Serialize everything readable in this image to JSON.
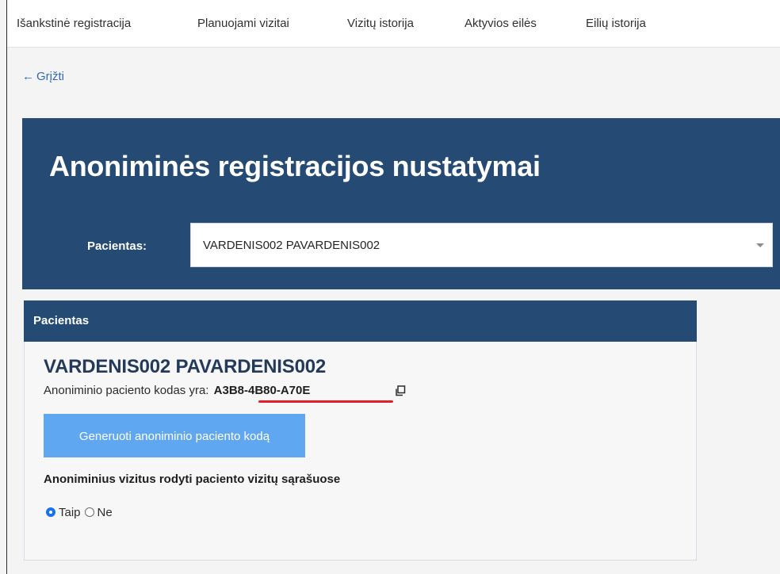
{
  "nav": {
    "items": [
      {
        "label": "Išankstinė registracija"
      },
      {
        "label": "Planuojami vizitai"
      },
      {
        "label": "Vizitų istorija"
      },
      {
        "label": "Aktyvios eilės"
      },
      {
        "label": "Eilių istorija"
      }
    ]
  },
  "back": {
    "arrow": "←",
    "label": "Grįžti"
  },
  "header": {
    "title": "Anoniminės registracijos nustatymai",
    "patient_label": "Pacientas:",
    "patient_selected": "VARDENIS002 PAVARDENIS002"
  },
  "card": {
    "title": "Pacientas",
    "patient_name": "VARDENIS002 PAVARDENIS002",
    "code_prefix": "Anoniminio paciento kodas yra:",
    "code_value": "A3B8-4B80-A70E",
    "copy_icon": "copy-icon",
    "generate_button": "Generuoti anoniminio paciento kodą",
    "visits_label": "Anoniminius vizitus rodyti paciento vizitų sąrašuose",
    "radio_options": [
      {
        "label": "Taip",
        "checked": true
      },
      {
        "label": "Ne",
        "checked": false
      }
    ]
  },
  "colors": {
    "primary_dark": "#254a73",
    "button_blue": "#5fa8f1",
    "link_blue": "#2f6ab6",
    "underline_red": "#e3202a"
  }
}
